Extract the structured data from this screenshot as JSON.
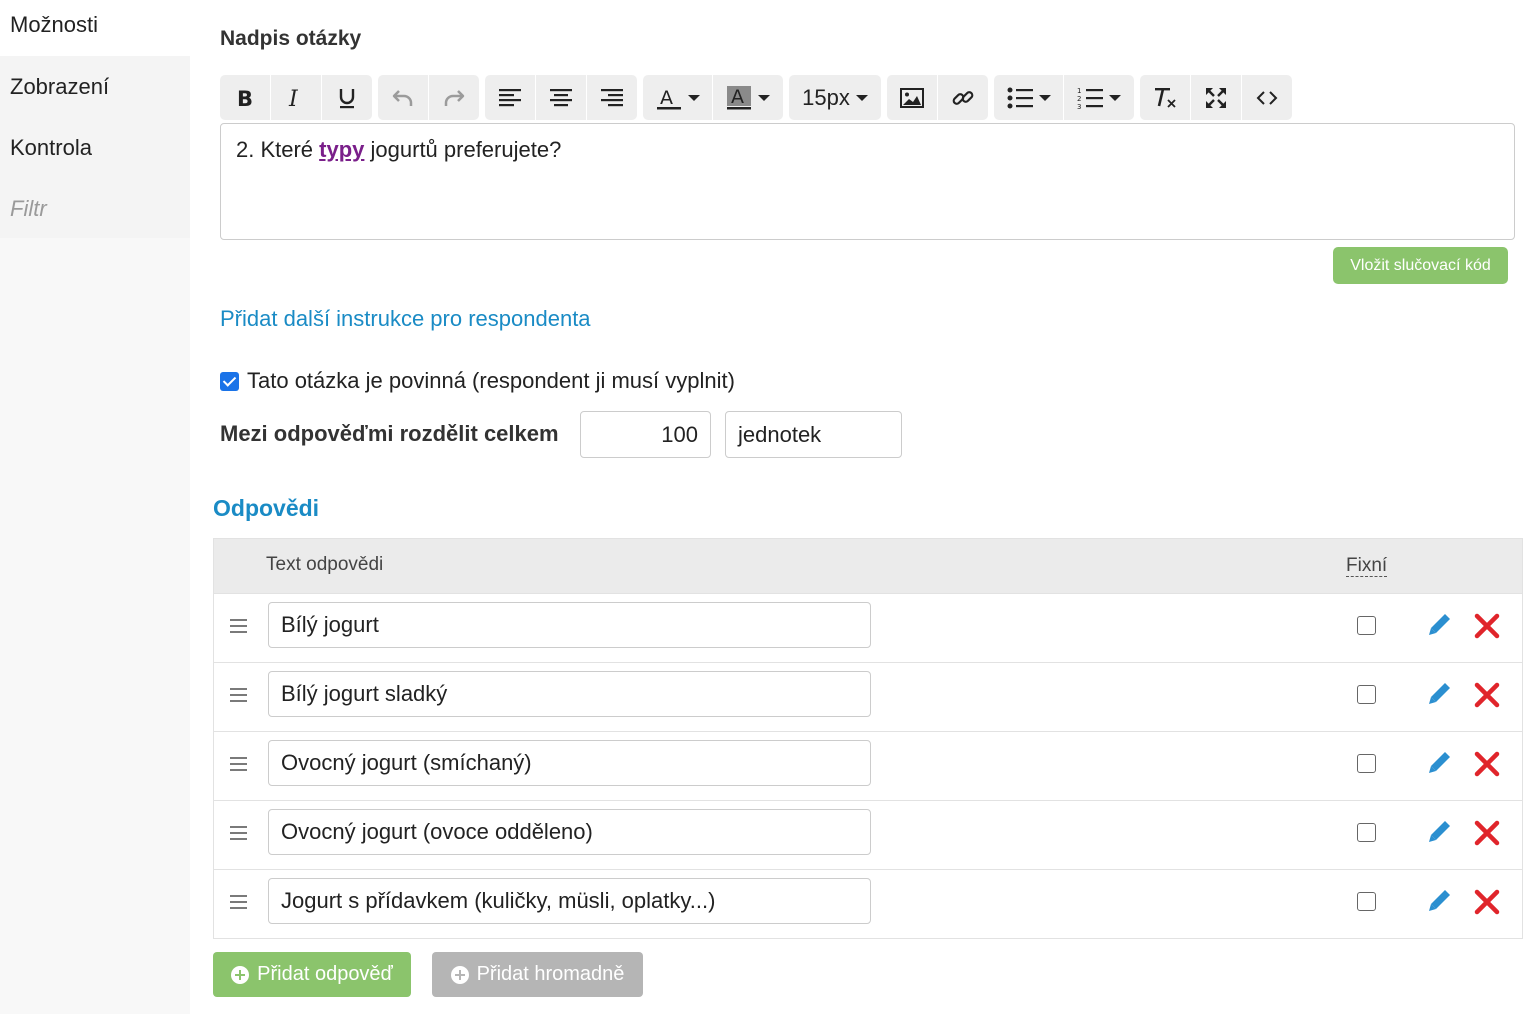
{
  "sidebar": {
    "items": [
      {
        "label": "Možnosti"
      },
      {
        "label": "Zobrazení"
      },
      {
        "label": "Kontrola"
      },
      {
        "label": "Filtr"
      }
    ]
  },
  "question": {
    "label": "Nadpis otázky",
    "text_before": "2. Které ",
    "text_highlight": "typy",
    "text_after": " jogurtů preferujete?"
  },
  "toolbar": {
    "font_size": "15px"
  },
  "merge_button": "Vložit slučovací kód",
  "instructions_link": "Přidat další instrukce pro respondenta",
  "required": {
    "label": "Tato otázka je povinná (respondent ji musí vyplnit)",
    "checked": true
  },
  "distribution": {
    "label": "Mezi odpověďmi rozdělit celkem",
    "total": "100",
    "unit": "jednotek"
  },
  "answers": {
    "title": "Odpovědi",
    "col_text": "Text odpovědi",
    "col_fixed": "Fixní",
    "rows": [
      {
        "text": "Bílý jogurt"
      },
      {
        "text": "Bílý jogurt sladký"
      },
      {
        "text": "Ovocný jogurt (smíchaný)"
      },
      {
        "text": "Ovocný jogurt (ovoce odděleno)"
      },
      {
        "text": "Jogurt s přídavkem (kuličky, müsli, oplatky...)"
      }
    ]
  },
  "buttons": {
    "add": "Přidat odpověď",
    "bulk": "Přidat hromadně"
  },
  "colors": {
    "accent_blue": "#1a8bc5",
    "green": "#8bc46c",
    "red": "#e0252b",
    "pencil": "#2b8fd0"
  }
}
